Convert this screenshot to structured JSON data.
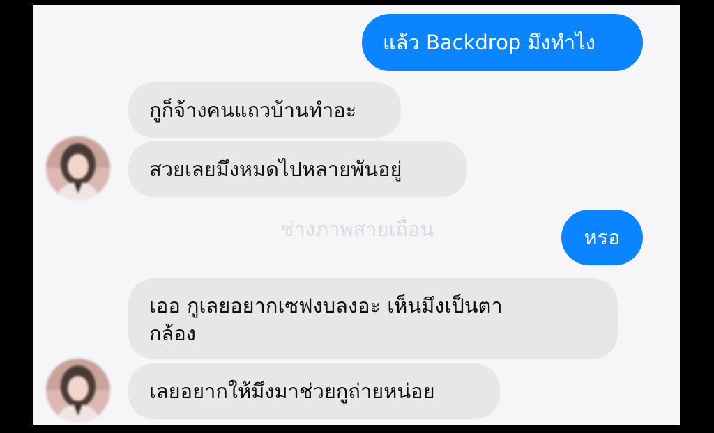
{
  "conversation": {
    "messages": [
      {
        "id": "m1",
        "direction": "outgoing",
        "text": "แล้ว Backdrop มึงทำไง"
      },
      {
        "id": "m2",
        "direction": "incoming",
        "text": "กูก็จ้างคนแถวบ้านทำอะ"
      },
      {
        "id": "m3",
        "direction": "incoming",
        "text": "สวยเลยมึงหมดไปหลายพันอยู่"
      },
      {
        "id": "m4",
        "direction": "outgoing",
        "text": "หรอ"
      },
      {
        "id": "m5",
        "direction": "incoming",
        "text": "เออ กูเลยอยากเซฟงบลงอะ เห็นมึงเป็นตา\nกล้อง"
      },
      {
        "id": "m6",
        "direction": "incoming",
        "text": "เลยอยากให้มึงมาช่วยกูถ่ายหน่อย"
      }
    ],
    "watermark": "ช่างภาพสายเถื่อน"
  },
  "colors": {
    "outgoing_bubble": "#0a84ff",
    "incoming_bubble": "#e7e7ea",
    "chat_background": "#f6f6f8",
    "outer_background": "#000000"
  },
  "icons": {
    "avatar": "contact-avatar-photo"
  }
}
